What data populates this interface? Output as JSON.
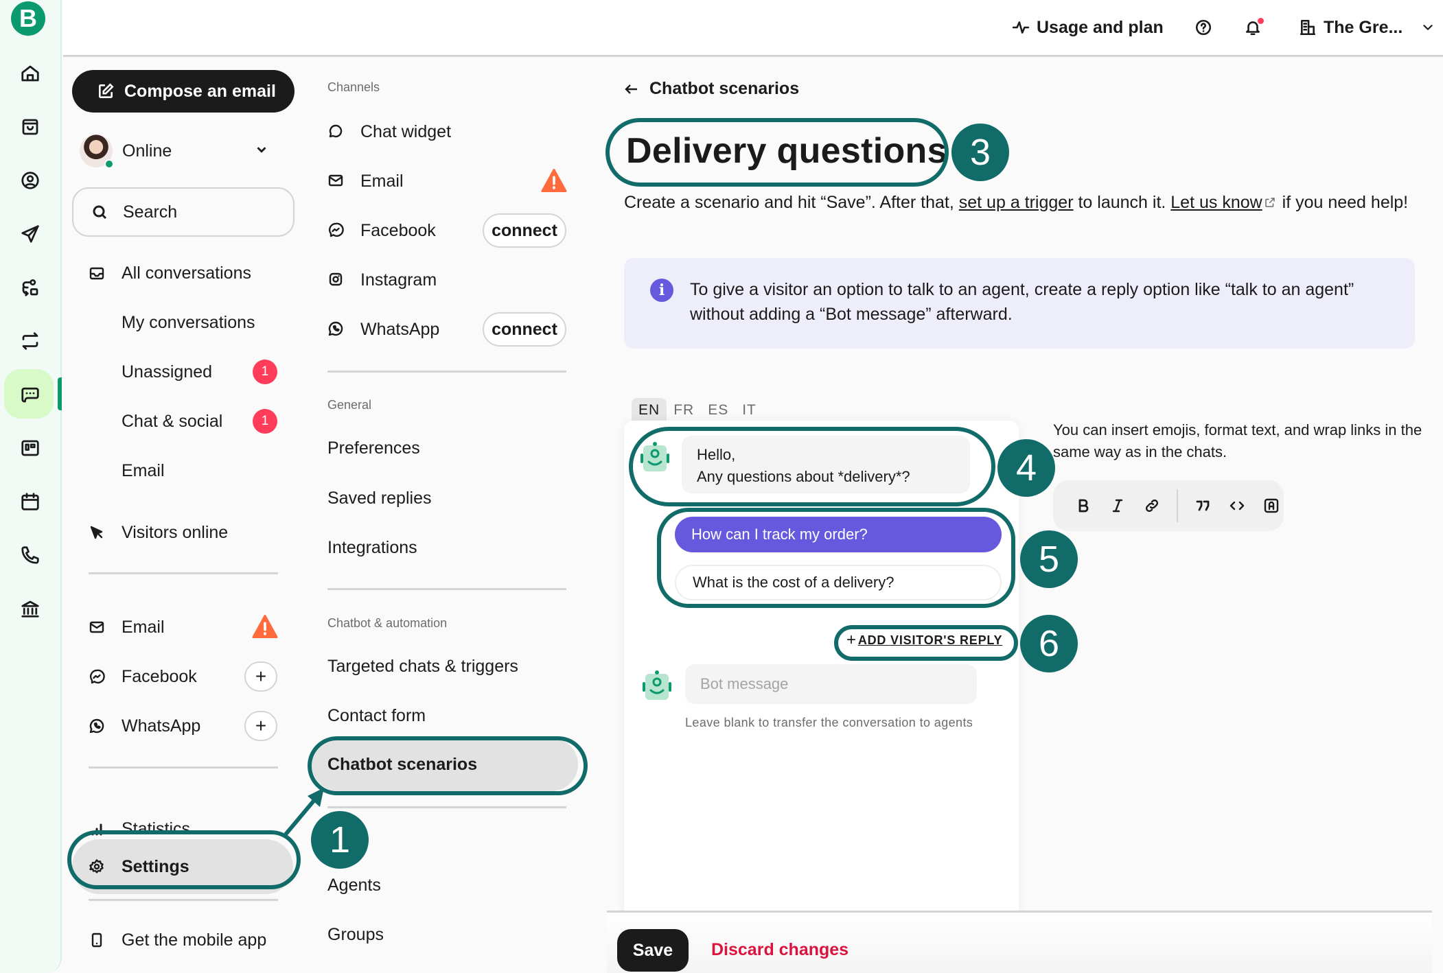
{
  "rail": {
    "logo": "B",
    "items": [
      {
        "icon": "home-icon"
      },
      {
        "icon": "inbox-box-icon"
      },
      {
        "icon": "contacts-icon"
      },
      {
        "icon": "send-icon"
      },
      {
        "icon": "automation-icon"
      },
      {
        "icon": "transactional-icon"
      },
      {
        "icon": "conversations-icon",
        "active": true
      },
      {
        "icon": "deals-icon"
      },
      {
        "icon": "calendar-icon"
      },
      {
        "icon": "phone-icon"
      },
      {
        "icon": "bank-icon"
      }
    ]
  },
  "topbar": {
    "usage_label": "Usage and plan",
    "account_label": "The Gre..."
  },
  "sidebar": {
    "compose_label": "Compose an email",
    "status_label": "Online",
    "search_placeholder": "Search",
    "conversations": [
      {
        "label": "All conversations",
        "icon": "inbox-icon"
      },
      {
        "label": "My conversations"
      },
      {
        "label": "Unassigned",
        "badge": "1"
      },
      {
        "label": "Chat & social",
        "badge": "1"
      },
      {
        "label": "Email"
      }
    ],
    "visitors_label": "Visitors online",
    "channels": [
      {
        "label": "Email",
        "icon": "mail-icon",
        "status": "warning"
      },
      {
        "label": "Facebook",
        "icon": "messenger-icon",
        "action": "+"
      },
      {
        "label": "WhatsApp",
        "icon": "whatsapp-icon",
        "action": "+"
      }
    ],
    "statistics_label": "Statistics",
    "settings_label": "Settings",
    "mobile_label": "Get the mobile app"
  },
  "settings_nav": {
    "channels_header": "Channels",
    "channels": [
      {
        "label": "Chat widget"
      },
      {
        "label": "Email",
        "status": "warning"
      },
      {
        "label": "Facebook",
        "action": "connect"
      },
      {
        "label": "Instagram"
      },
      {
        "label": "WhatsApp",
        "action": "connect"
      }
    ],
    "general_header": "General",
    "general": [
      "Preferences",
      "Saved replies",
      "Integrations"
    ],
    "automation_header": "Chatbot & automation",
    "automation": [
      "Targeted chats & triggers",
      "Contact form",
      "Chatbot scenarios"
    ],
    "team": [
      "Agents",
      "Groups"
    ]
  },
  "main": {
    "back_label": "Chatbot scenarios",
    "title": "Delivery questions",
    "desc_part1": "Create a scenario and hit “Save”. After that, ",
    "desc_link1": "set up a trigger",
    "desc_part2": " to launch it. ",
    "desc_link2": "Let us know",
    "desc_part3": " if you need help!",
    "info_text": "To give a visitor an option to talk to an agent, create a reply option like “talk to an agent” without adding a “Bot message” afterward.",
    "languages": [
      "EN",
      "FR",
      "ES",
      "IT"
    ],
    "active_language": "EN",
    "bot_message_line1": "Hello,",
    "bot_message_line2": "Any questions about *delivery*?",
    "replies": [
      "How can I track my order?",
      "What is the cost of a delivery?"
    ],
    "add_reply_label": "ADD VISITOR'S REPLY",
    "bot_message_placeholder": "Bot message",
    "bot_message_hint": "Leave blank to transfer the conversation to agents",
    "format_tip": "You can insert emojis, format text, and wrap links in the same way as in the chats.",
    "format_tools": [
      "bold",
      "italic",
      "link",
      "quote",
      "code",
      "variable"
    ],
    "save_label": "Save",
    "discard_label": "Discard changes"
  },
  "annotations": [
    "1",
    "3",
    "4",
    "5",
    "6"
  ],
  "colors": {
    "brand": "#0b996e",
    "annotation": "#116b68",
    "reply_primary": "#6759de",
    "badge": "#ff3d5a",
    "warning": "#ff6b3d",
    "discard": "#d9143f"
  }
}
